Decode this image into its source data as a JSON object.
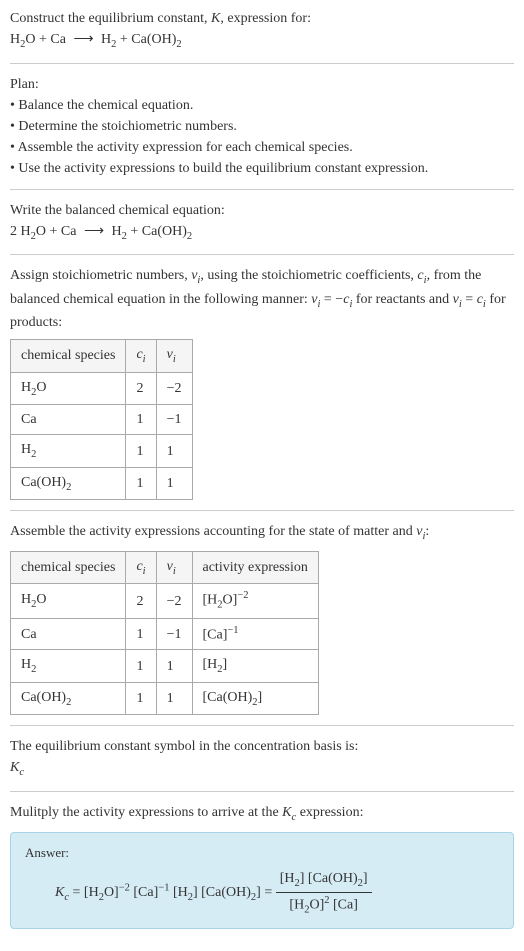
{
  "intro": {
    "line1": "Construct the equilibrium constant, K, expression for:",
    "equation": "H₂O + Ca ⟶ H₂ + Ca(OH)₂"
  },
  "plan": {
    "title": "Plan:",
    "items": [
      "Balance the chemical equation.",
      "Determine the stoichiometric numbers.",
      "Assemble the activity expression for each chemical species.",
      "Use the activity expressions to build the equilibrium constant expression."
    ]
  },
  "balanced": {
    "title": "Write the balanced chemical equation:",
    "equation": "2 H₂O + Ca ⟶ H₂ + Ca(OH)₂"
  },
  "stoich": {
    "intro": "Assign stoichiometric numbers, νᵢ, using the stoichiometric coefficients, cᵢ, from the balanced chemical equation in the following manner: νᵢ = −cᵢ for reactants and νᵢ = cᵢ for products:",
    "headers": [
      "chemical species",
      "cᵢ",
      "νᵢ"
    ],
    "rows": [
      {
        "species": "H₂O",
        "c": "2",
        "v": "−2"
      },
      {
        "species": "Ca",
        "c": "1",
        "v": "−1"
      },
      {
        "species": "H₂",
        "c": "1",
        "v": "1"
      },
      {
        "species": "Ca(OH)₂",
        "c": "1",
        "v": "1"
      }
    ]
  },
  "activity": {
    "intro": "Assemble the activity expressions accounting for the state of matter and νᵢ:",
    "headers": [
      "chemical species",
      "cᵢ",
      "νᵢ",
      "activity expression"
    ],
    "rows": [
      {
        "species": "H₂O",
        "c": "2",
        "v": "−2",
        "expr": "[H₂O]⁻²"
      },
      {
        "species": "Ca",
        "c": "1",
        "v": "−1",
        "expr": "[Ca]⁻¹"
      },
      {
        "species": "H₂",
        "c": "1",
        "v": "1",
        "expr": "[H₂]"
      },
      {
        "species": "Ca(OH)₂",
        "c": "1",
        "v": "1",
        "expr": "[Ca(OH)₂]"
      }
    ]
  },
  "symbol": {
    "line1": "The equilibrium constant symbol in the concentration basis is:",
    "line2": "K_c"
  },
  "multiply": {
    "text": "Mulitply the activity expressions to arrive at the K_c expression:"
  },
  "answer": {
    "label": "Answer:",
    "lhs": "K_c = [H₂O]⁻² [Ca]⁻¹ [H₂] [Ca(OH)₂] =",
    "num": "[H₂] [Ca(OH)₂]",
    "den": "[H₂O]² [Ca]"
  }
}
